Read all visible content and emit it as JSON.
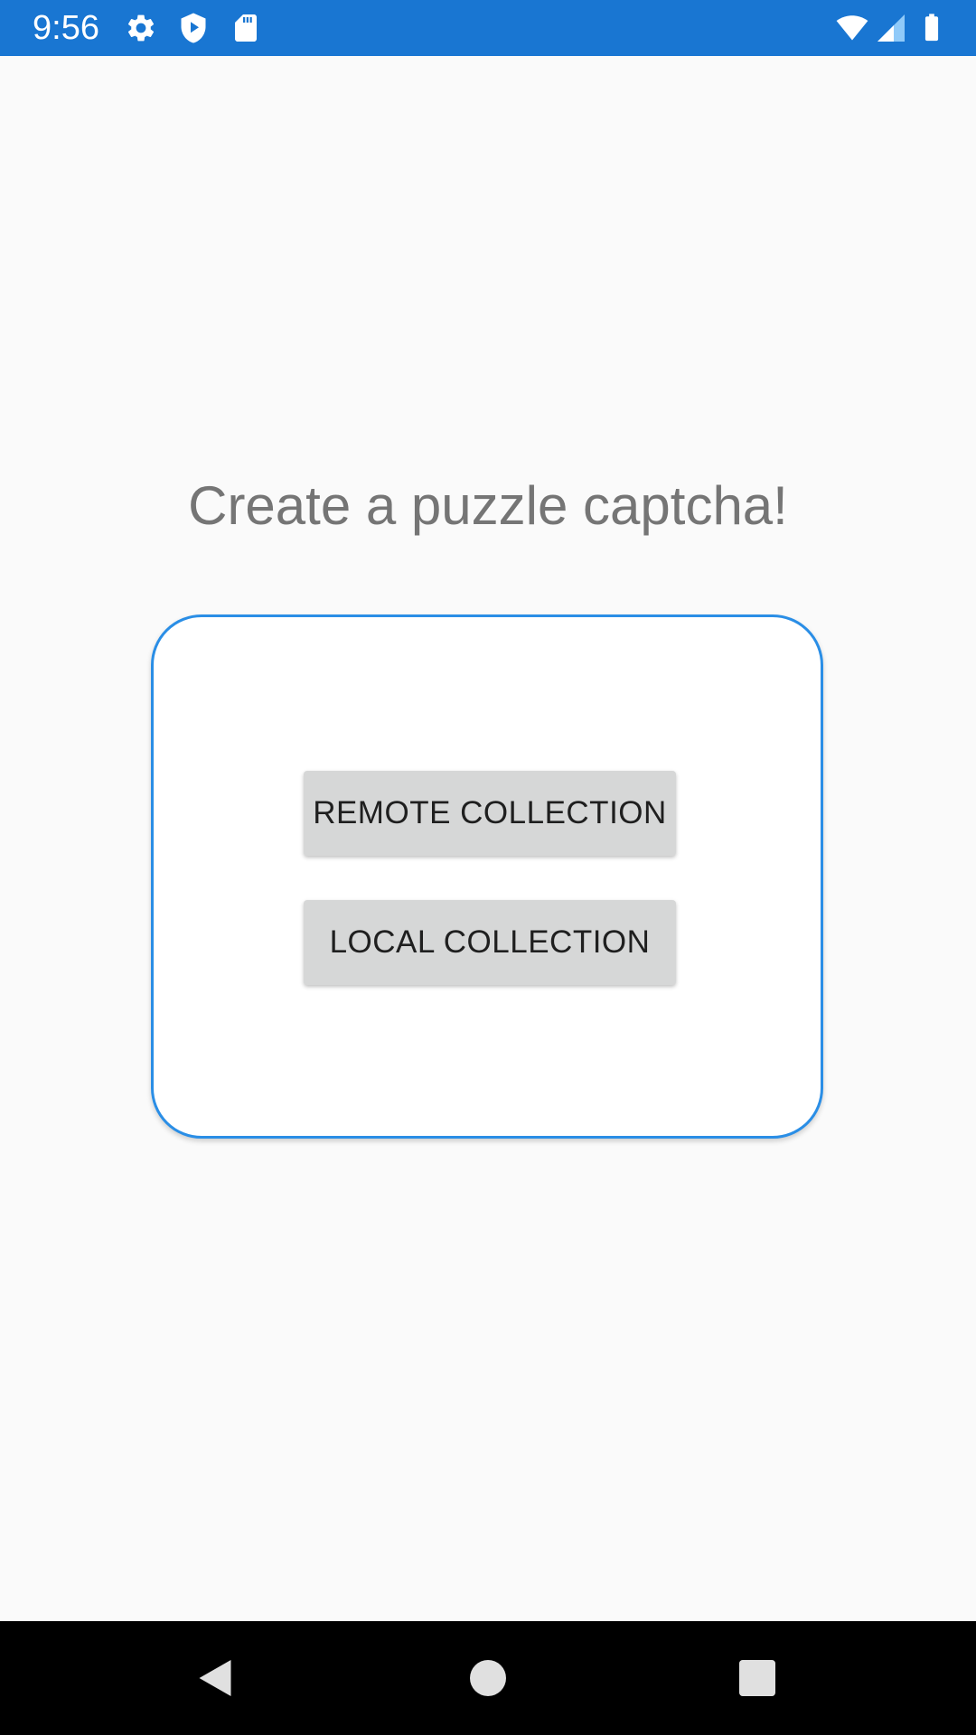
{
  "status_bar": {
    "time": "9:56",
    "background_color": "#1976d2",
    "left_icons": [
      "gear-icon",
      "shield-play-icon",
      "sd-card-icon"
    ],
    "right_icons": [
      "wifi-icon",
      "cell-signal-icon",
      "battery-icon"
    ]
  },
  "main": {
    "title": "Create a puzzle captcha!",
    "card_border_color": "#2a8ee6",
    "buttons": {
      "remote_label": "REMOTE COLLECTION",
      "local_label": "LOCAL COLLECTION"
    }
  },
  "nav_bar": {
    "items": [
      "back-icon",
      "home-icon",
      "recents-icon"
    ]
  }
}
